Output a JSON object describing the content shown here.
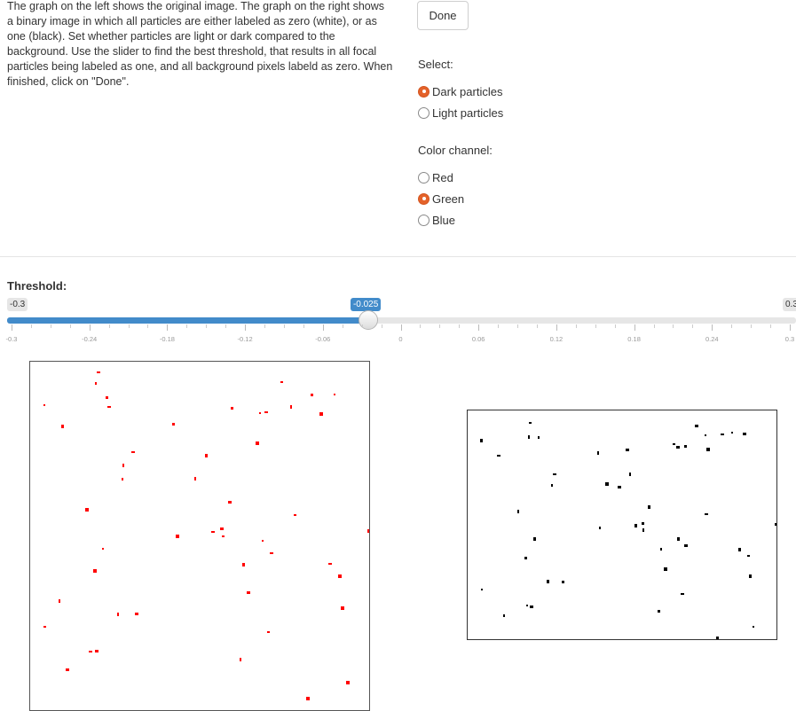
{
  "instructions": "The graph on the left shows the original image. The graph on the right shows a binary image in which all particles are either labeled as zero (white), or as one (black). Set whether particles are light or dark compared to the background. Use the slider to find the best threshold, that results in all focal particles being labeled as one, and all background pixels labeld as zero. When finished, click on \"Done\".",
  "done_button": "Done",
  "select": {
    "label": "Select:",
    "options": [
      {
        "label": "Dark particles",
        "checked": true
      },
      {
        "label": "Light particles",
        "checked": false
      }
    ]
  },
  "channel": {
    "label": "Color channel:",
    "options": [
      {
        "label": "Red",
        "checked": false
      },
      {
        "label": "Green",
        "checked": true
      },
      {
        "label": "Blue",
        "checked": false
      }
    ]
  },
  "threshold": {
    "label": "Threshold:",
    "min_label": "-0.3",
    "max_label": "0.3",
    "value_label": "-0.025",
    "min": -0.3,
    "max": 0.3,
    "value": -0.025,
    "tick_labels": [
      "-0.3",
      "-0.24",
      "-0.18",
      "-0.12",
      "-0.06",
      "0",
      "0.06",
      "0.12",
      "0.18",
      "0.24",
      "0.3"
    ]
  },
  "colors": {
    "accent": "#428bca",
    "radio_checked": "#e4622a",
    "particle_original": "#ff0000",
    "particle_binary": "#000000"
  },
  "images": {
    "original": "scatter of small red particles",
    "binary": "scatter of small black particles"
  }
}
